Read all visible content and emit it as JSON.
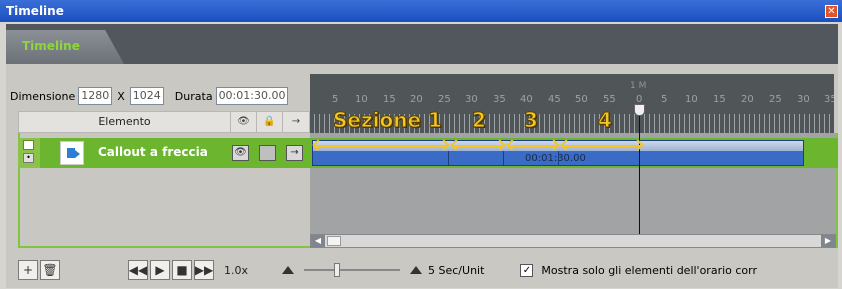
{
  "window": {
    "title": "Timeline",
    "close_icon": "close-icon"
  },
  "tab": {
    "label": "Timeline"
  },
  "controls": {
    "dimensione_label": "Dimensione",
    "width_value": "1280",
    "x_label": "X",
    "height_value": "1024",
    "durata_label": "Durata",
    "durata_value": "00:01:30.00"
  },
  "columns": {
    "elemento": "Elemento",
    "eye": "👁",
    "lock": "🔒",
    "arrow": "→"
  },
  "ruler": {
    "top_label": "1 M",
    "ticks": [
      "5",
      "10",
      "15",
      "20",
      "25",
      "30",
      "35",
      "40",
      "45",
      "50",
      "55",
      "0",
      "5",
      "10",
      "15",
      "20",
      "25",
      "30",
      "35"
    ]
  },
  "track": {
    "label": "Callout a freccia",
    "eye": "👁",
    "arrow": "→",
    "clip_time": "00:01:30.00"
  },
  "sections": [
    "Sezione 1",
    "2",
    "3",
    "4"
  ],
  "bottom": {
    "speed": "1.0x",
    "zoom_unit": "5 Sec/Unit",
    "checkbox_label": "Mostra solo gli elementi dell'orario corr",
    "checkbox_checked": true
  },
  "colors": {
    "accent_green": "#82c341",
    "section_yellow": "#f5c623",
    "clip_blue": "#3a6cc6"
  }
}
